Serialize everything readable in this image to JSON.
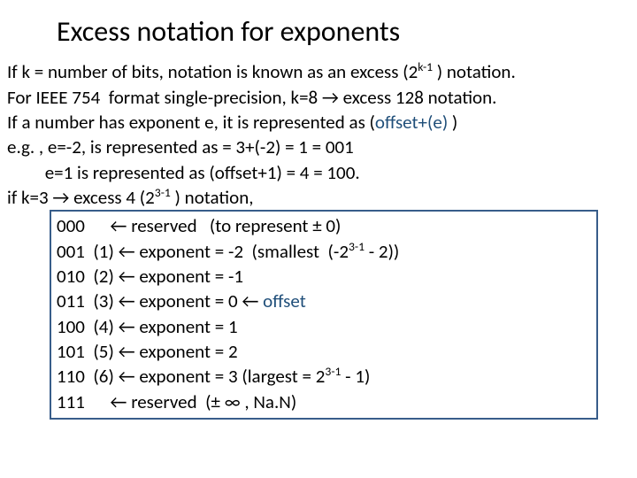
{
  "title": "Excess notation for exponents",
  "body": {
    "line1_pre": "If k = number of bits, notation is known as an excess (2",
    "line1_sup": "k-1",
    "line1_post": " ) notation.",
    "line2": "For IEEE 754  format single-precision, k=8 → excess 128 notation.",
    "line3_pre": "If a number has exponent e, it is represented as (",
    "line3_offset": "offset+(e)",
    "line3_post": " )",
    "line4": "e.g. , e=-2, is represented as = 3+(-2) = 1 = 001",
    "line5": "         e=1 is represented as (offset+1) = 4 = 100.",
    "line6_pre": "if k=3 → excess 4 (2",
    "line6_sup": "3-1",
    "line6_post": " ) notation,"
  },
  "table": {
    "r0_bits": "000",
    "r0_dec": "     ",
    "r0_rest": " ← reserved   (to represent ± 0)",
    "r1_bits": "001",
    "r1_dec": "  (1) ",
    "r1_pre": "← exponent = -2  (smallest  (-2",
    "r1_sup": "3-1",
    "r1_post": " - 2))",
    "r2_bits": "010",
    "r2_dec": "  (2) ",
    "r2_rest": "← exponent = -1",
    "r3_bits": "011",
    "r3_dec": "  (3) ",
    "r3_rest_a": "← exponent = 0 ← ",
    "r3_rest_b": "offset",
    "r4_bits": "100",
    "r4_dec": "  (4) ",
    "r4_rest": "← exponent = 1",
    "r5_bits": "101",
    "r5_dec": "  (5) ",
    "r5_rest": "← exponent = 2",
    "r6_bits": "110",
    "r6_dec": "  (6) ",
    "r6_pre": "← exponent = 3 (largest = 2",
    "r6_sup": "3-1",
    "r6_post": " - 1)",
    "r7_bits": "111",
    "r7_dec": "     ",
    "r7_rest": " ← reserved  (± ∞ , Na.N)"
  }
}
